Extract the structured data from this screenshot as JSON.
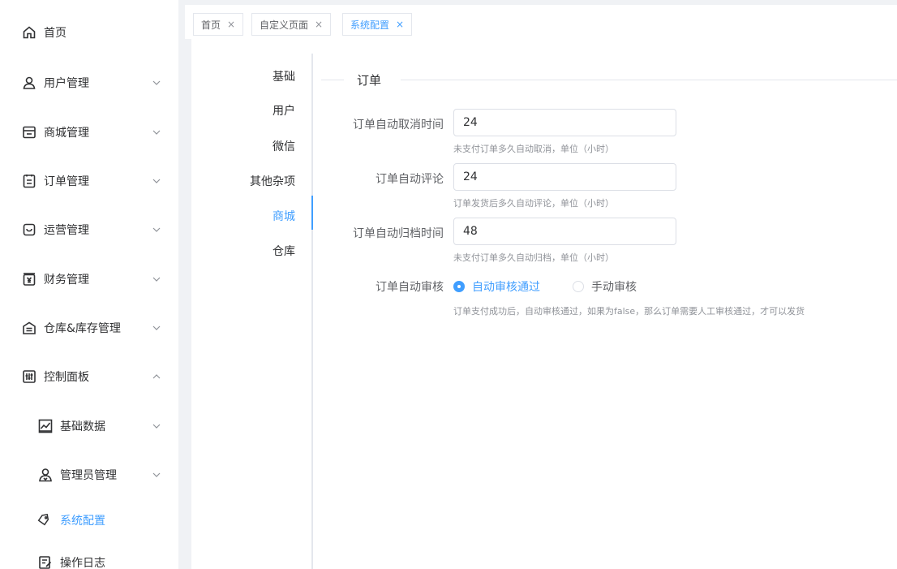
{
  "sidebar": {
    "items": [
      {
        "label": "首页",
        "icon": "home-icon"
      },
      {
        "label": "用户管理",
        "icon": "user-icon"
      },
      {
        "label": "商城管理",
        "icon": "store-icon"
      },
      {
        "label": "订单管理",
        "icon": "order-icon"
      },
      {
        "label": "运营管理",
        "icon": "operation-icon"
      },
      {
        "label": "财务管理",
        "icon": "finance-icon"
      },
      {
        "label": "仓库&库存管理",
        "icon": "warehouse-icon"
      },
      {
        "label": "控制面板",
        "icon": "control-panel-icon"
      },
      {
        "label": "基础数据",
        "icon": "chart-icon"
      },
      {
        "label": "管理员管理",
        "icon": "admin-icon"
      },
      {
        "label": "系统配置",
        "icon": "tag-icon"
      },
      {
        "label": "操作日志",
        "icon": "log-icon"
      }
    ],
    "active_color": "#409eff"
  },
  "tabs": [
    {
      "label": "首页",
      "close": "×"
    },
    {
      "label": "自定义页面",
      "close": "×"
    },
    {
      "label": "系统配置",
      "close": "×"
    }
  ],
  "vtabs": [
    "基础",
    "用户",
    "微信",
    "其他杂项",
    "商城",
    "仓库"
  ],
  "section": {
    "title": "订单"
  },
  "form": {
    "cancel": {
      "label": "订单自动取消时间",
      "value": "24",
      "help": "未支付订单多久自动取消，单位（小时）"
    },
    "comment": {
      "label": "订单自动评论",
      "value": "24",
      "help": "订单发货后多久自动评论，单位（小时）"
    },
    "archive": {
      "label": "订单自动归档时间",
      "value": "48",
      "help": "未支付订单多久自动归档，单位（小时）"
    },
    "audit": {
      "label": "订单自动审核",
      "options": [
        "自动审核通过",
        "手动审核"
      ],
      "selected": "自动审核通过",
      "help": "订单支付成功后，自动审核通过，如果为false，那么订单需要人工审核通过，才可以发货"
    }
  }
}
